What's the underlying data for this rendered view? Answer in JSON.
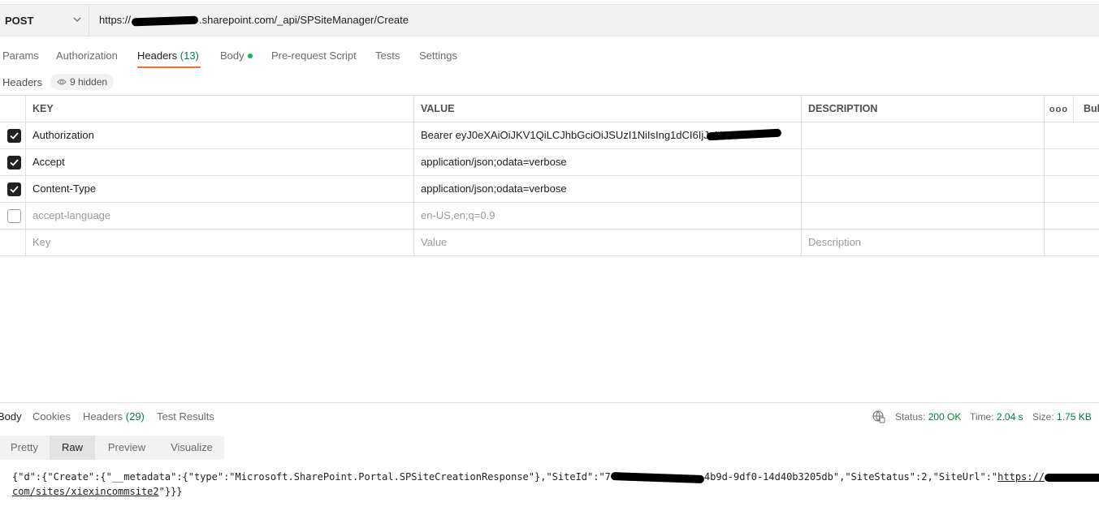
{
  "request": {
    "method": "POST",
    "url_prefix": "https://",
    "url_suffix": ".sharepoint.com/_api/SPSiteManager/Create"
  },
  "tabs": [
    {
      "label": "Params"
    },
    {
      "label": "Authorization"
    },
    {
      "label": "Headers",
      "count": "(13)"
    },
    {
      "label": "Body"
    },
    {
      "label": "Pre-request Script"
    },
    {
      "label": "Tests"
    },
    {
      "label": "Settings"
    }
  ],
  "headers_section": {
    "title": "Headers",
    "hidden_label": "9 hidden"
  },
  "table": {
    "columns": {
      "key": "KEY",
      "value": "VALUE",
      "description": "DESCRIPTION",
      "more": "ooo",
      "bulk": "Bulk"
    },
    "rows": [
      {
        "checked": true,
        "key": "Authorization",
        "value": "Bearer eyJ0eXAiOiJKV1QiLCJhbGciOiJSUzI1NiIsIng1dCI6IjJaU"
      },
      {
        "checked": true,
        "key": "Accept",
        "value": "application/json;odata=verbose"
      },
      {
        "checked": true,
        "key": "Content-Type",
        "value": "application/json;odata=verbose"
      },
      {
        "checked": false,
        "key": "accept-language",
        "value": "en-US,en;q=0.9"
      }
    ],
    "placeholders": {
      "key": "Key",
      "value": "Value",
      "description": "Description"
    }
  },
  "response": {
    "tabs": [
      {
        "label": "Body"
      },
      {
        "label": "Cookies"
      },
      {
        "label": "Headers",
        "count": "(29)"
      },
      {
        "label": "Test Results"
      }
    ],
    "status_label": "Status:",
    "status_value": "200 OK",
    "time_label": "Time:",
    "time_value": "2.04 s",
    "size_label": "Size:",
    "size_value": "1.75 KB",
    "view_modes": [
      "Pretty",
      "Raw",
      "Preview",
      "Visualize"
    ],
    "selected_view": "Raw",
    "raw_line1_a": "{\"d\":{\"Create\":{\"__metadata\":{\"type\":\"Microsoft.SharePoint.Portal.SPSiteCreationResponse\"},\"SiteId\":\"7",
    "raw_line1_b": "4b9d-9df0-14d40b3205db\",\"SiteStatus\":2,\"SiteUrl\":\"",
    "raw_line1_link": "https://",
    "raw_line2_link": "com/sites/xiexincommsite2",
    "raw_line2_end": "\"}}}"
  },
  "colors": {
    "accent": "#ff6c37",
    "success": "#0c7a43",
    "body_dot": "#0cbb52"
  }
}
